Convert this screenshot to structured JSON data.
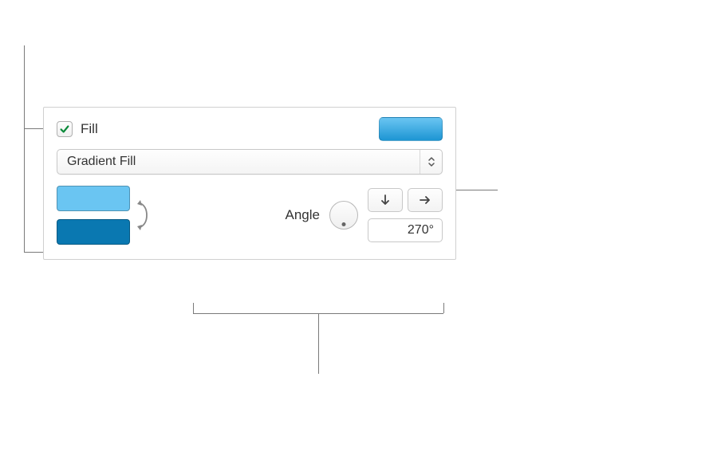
{
  "fill": {
    "checkbox_checked": true,
    "label": "Fill",
    "type_label": "Gradient Fill",
    "colors": {
      "color1": "#6ac5f2",
      "color2": "#0a78b1"
    },
    "angle": {
      "label": "Angle",
      "value": "270°"
    }
  }
}
